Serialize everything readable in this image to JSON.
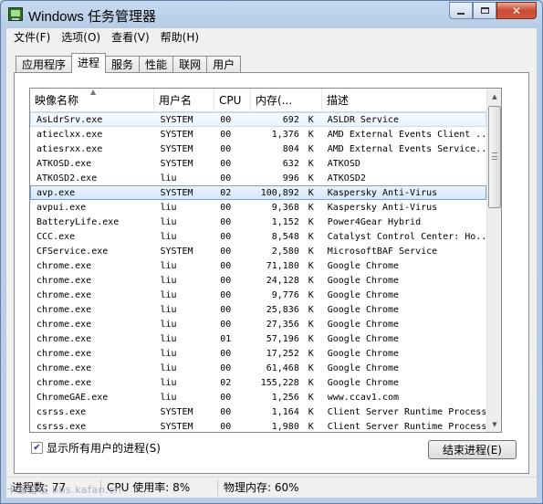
{
  "window": {
    "title": "Windows 任务管理器",
    "controls": {
      "minimize": "minimize",
      "maximize": "maximize",
      "close": "✕"
    }
  },
  "menu": [
    "文件(F)",
    "选项(O)",
    "查看(V)",
    "帮助(H)"
  ],
  "tabs": [
    {
      "label": "应用程序",
      "active": false
    },
    {
      "label": "进程",
      "active": true
    },
    {
      "label": "服务",
      "active": false
    },
    {
      "label": "性能",
      "active": false
    },
    {
      "label": "联网",
      "active": false
    },
    {
      "label": "用户",
      "active": false
    }
  ],
  "columns": {
    "name": "映像名称",
    "user": "用户名",
    "cpu": "CPU",
    "memory": "内存(...",
    "description": "描述"
  },
  "processes": [
    {
      "name": "AsLdrSrv.exe",
      "user": "SYSTEM",
      "cpu": "00",
      "mem": "692",
      "unit": "K",
      "desc": "ASLDR Service",
      "state": "hover"
    },
    {
      "name": "atieclxx.exe",
      "user": "SYSTEM",
      "cpu": "00",
      "mem": "1,376",
      "unit": "K",
      "desc": "AMD External Events Client ...",
      "state": ""
    },
    {
      "name": "atiesrxx.exe",
      "user": "SYSTEM",
      "cpu": "00",
      "mem": "804",
      "unit": "K",
      "desc": "AMD External Events Service...",
      "state": ""
    },
    {
      "name": "ATKOSD.exe",
      "user": "SYSTEM",
      "cpu": "00",
      "mem": "632",
      "unit": "K",
      "desc": "ATKOSD",
      "state": ""
    },
    {
      "name": "ATKOSD2.exe",
      "user": "liu",
      "cpu": "00",
      "mem": "996",
      "unit": "K",
      "desc": "ATKOSD2",
      "state": ""
    },
    {
      "name": "avp.exe",
      "user": "SYSTEM",
      "cpu": "02",
      "mem": "100,892",
      "unit": "K",
      "desc": "Kaspersky Anti-Virus",
      "state": "selected"
    },
    {
      "name": "avpui.exe",
      "user": "liu",
      "cpu": "00",
      "mem": "9,368",
      "unit": "K",
      "desc": "Kaspersky Anti-Virus",
      "state": ""
    },
    {
      "name": "BatteryLife.exe",
      "user": "liu",
      "cpu": "00",
      "mem": "1,152",
      "unit": "K",
      "desc": "Power4Gear Hybrid",
      "state": ""
    },
    {
      "name": "CCC.exe",
      "user": "liu",
      "cpu": "00",
      "mem": "8,548",
      "unit": "K",
      "desc": "Catalyst Control Center: Ho...",
      "state": ""
    },
    {
      "name": "CFService.exe",
      "user": "SYSTEM",
      "cpu": "00",
      "mem": "2,580",
      "unit": "K",
      "desc": "MicrosoftBAF Service",
      "state": ""
    },
    {
      "name": "chrome.exe",
      "user": "liu",
      "cpu": "00",
      "mem": "71,180",
      "unit": "K",
      "desc": "Google Chrome",
      "state": ""
    },
    {
      "name": "chrome.exe",
      "user": "liu",
      "cpu": "00",
      "mem": "24,128",
      "unit": "K",
      "desc": "Google Chrome",
      "state": ""
    },
    {
      "name": "chrome.exe",
      "user": "liu",
      "cpu": "00",
      "mem": "9,776",
      "unit": "K",
      "desc": "Google Chrome",
      "state": ""
    },
    {
      "name": "chrome.exe",
      "user": "liu",
      "cpu": "00",
      "mem": "25,836",
      "unit": "K",
      "desc": "Google Chrome",
      "state": ""
    },
    {
      "name": "chrome.exe",
      "user": "liu",
      "cpu": "00",
      "mem": "27,356",
      "unit": "K",
      "desc": "Google Chrome",
      "state": ""
    },
    {
      "name": "chrome.exe",
      "user": "liu",
      "cpu": "01",
      "mem": "57,196",
      "unit": "K",
      "desc": "Google Chrome",
      "state": ""
    },
    {
      "name": "chrome.exe",
      "user": "liu",
      "cpu": "00",
      "mem": "17,252",
      "unit": "K",
      "desc": "Google Chrome",
      "state": ""
    },
    {
      "name": "chrome.exe",
      "user": "liu",
      "cpu": "00",
      "mem": "61,468",
      "unit": "K",
      "desc": "Google Chrome",
      "state": ""
    },
    {
      "name": "chrome.exe",
      "user": "liu",
      "cpu": "02",
      "mem": "155,228",
      "unit": "K",
      "desc": "Google Chrome",
      "state": ""
    },
    {
      "name": "ChromeGAE.exe",
      "user": "liu",
      "cpu": "00",
      "mem": "1,256",
      "unit": "K",
      "desc": "www.ccav1.com",
      "state": ""
    },
    {
      "name": "csrss.exe",
      "user": "SYSTEM",
      "cpu": "00",
      "mem": "1,164",
      "unit": "K",
      "desc": "Client Server Runtime Process",
      "state": ""
    },
    {
      "name": "csrss.exe",
      "user": "SYSTEM",
      "cpu": "00",
      "mem": "1,980",
      "unit": "K",
      "desc": "Client Server Runtime Process",
      "state": ""
    }
  ],
  "scrollbar": {
    "up": "▲",
    "down": "▼"
  },
  "show_all": {
    "label": "显示所有用户的进程(S)",
    "checked": true,
    "check_glyph": "✔"
  },
  "end_process": {
    "label": "结束进程(E)"
  },
  "status": {
    "processes": "进程数: 77",
    "cpu": "CPU 使用率: 8%",
    "memory": "物理内存: 60%"
  },
  "watermark": "卡饭论坛 bbs.kafan.cn"
}
